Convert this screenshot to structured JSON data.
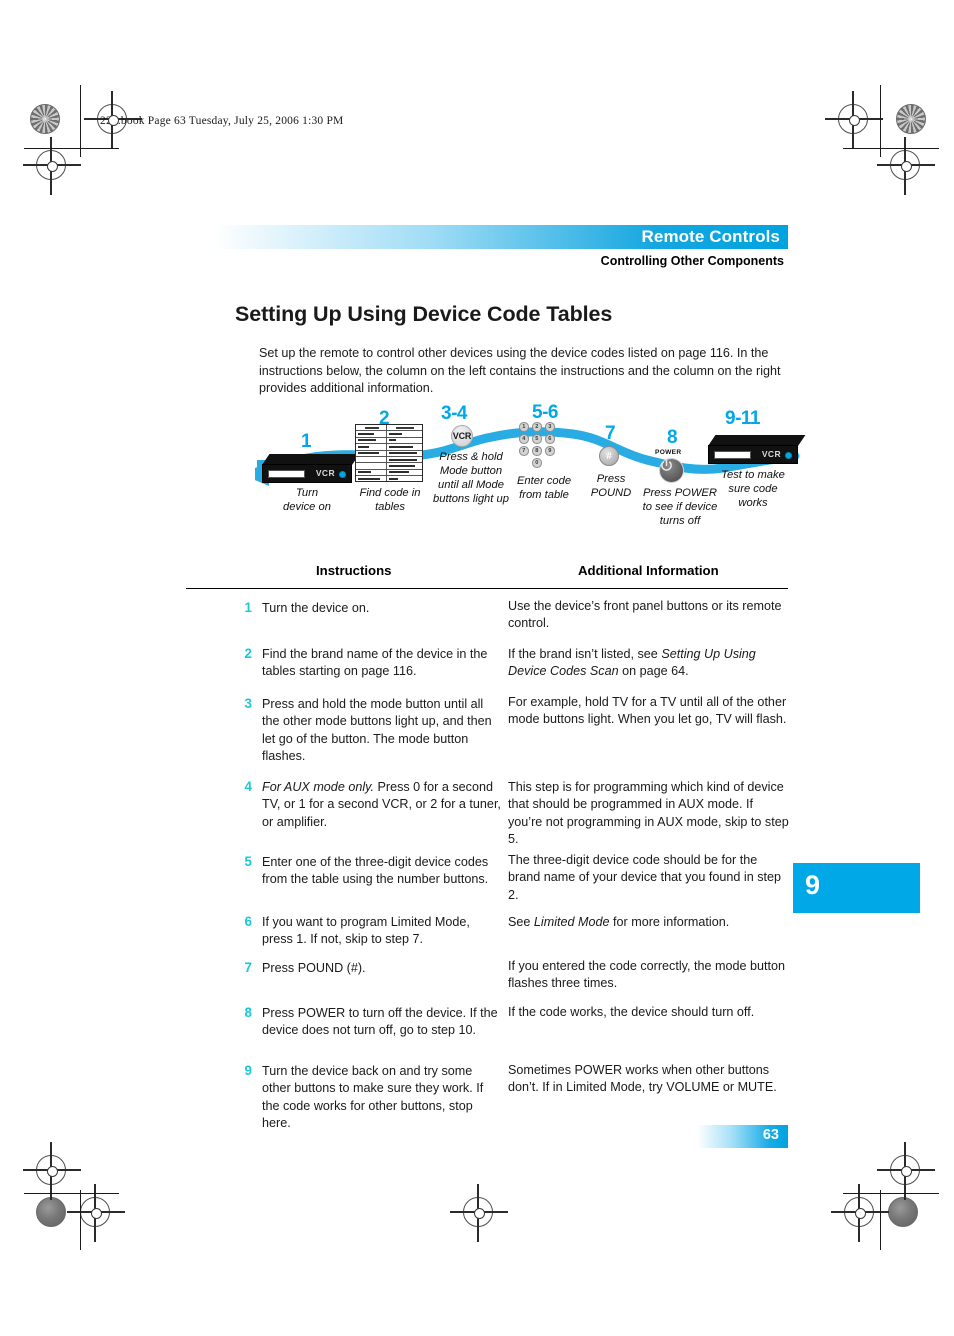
{
  "print_slug": "222.book  Page 63  Tuesday, July 25, 2006  1:30 PM",
  "header": {
    "bar_title": "Remote Controls",
    "subtitle": "Controlling Other Components"
  },
  "page_title": "Setting Up Using Device Code Tables",
  "intro": "Set up the remote to control other devices using the device codes listed on page 116. In the instructions below, the column on the left contains the instructions and the column on the right provides additional information.",
  "diagram": {
    "steps": [
      {
        "number": "1",
        "caption": "Turn\ndevice on",
        "icon": "device-box-icon"
      },
      {
        "number": "2",
        "caption": "Find code in\ntables",
        "icon": "code-table-icon"
      },
      {
        "number": "3-4",
        "caption": "Press & hold\nMode button\nuntil all Mode\nbuttons light up",
        "icon": "vcr-mode-button-icon"
      },
      {
        "number": "5-6",
        "caption": "Enter code\nfrom table",
        "icon": "number-keypad-icon"
      },
      {
        "number": "7",
        "caption": "Press\nPOUND",
        "icon": "pound-button-icon"
      },
      {
        "number": "8",
        "caption": "Press POWER\nto see if device\nturns off",
        "icon": "power-button-icon"
      },
      {
        "number": "9-11",
        "caption": "Test to make\nsure code\nworks",
        "icon": "device-box-icon"
      }
    ],
    "mode_button_label": "VCR",
    "pound_button_label": "#",
    "power_button_label": "POWER",
    "device_label": "VCR",
    "keypad_keys": [
      "1",
      "2",
      "3",
      "4",
      "5",
      "6",
      "7",
      "8",
      "9",
      "0"
    ]
  },
  "table": {
    "columns": [
      "Instructions",
      "Additional Information"
    ],
    "rows": [
      {
        "number": "1",
        "instruction": "Turn the device on.",
        "additional": "Use the device’s front panel buttons or its remote control."
      },
      {
        "number": "2",
        "instruction": "Find the brand name of the device in the tables starting on page 116.",
        "additional_pre": "If the brand isn’t listed, see ",
        "additional_em": "Setting Up Using Device Codes Scan",
        "additional_post": " on page 64."
      },
      {
        "number": "3",
        "instruction": "Press and hold the mode button until all the other mode buttons light up, and then let go of the button. The mode button flashes.",
        "additional": "For example, hold TV for a TV until all of the other mode buttons light. When you let go, TV will flash."
      },
      {
        "number": "4",
        "instruction_em": "For AUX mode only.",
        "instruction_post": " Press 0 for a second TV, or 1 for a second VCR, or 2 for a tuner, or amplifier.",
        "additional": "This step is for programming which kind of device that should be programmed in AUX mode. If you’re not programming in AUX mode, skip to step 5."
      },
      {
        "number": "5",
        "instruction": "Enter one of the three-digit device codes from the table using the number buttons.",
        "additional": "The three-digit device code should be for the brand name of your device that you found in step 2."
      },
      {
        "number": "6",
        "instruction": "If you want to program Limited Mode, press 1. If not, skip to step 7.",
        "additional_pre": "See ",
        "additional_em": "Limited Mode",
        "additional_post": " for more information."
      },
      {
        "number": "7",
        "instruction": "Press POUND (#).",
        "additional": "If you entered the code correctly, the mode button flashes three times."
      },
      {
        "number": "8",
        "instruction": "Press POWER to turn off the device. If the device does not turn off, go to step 10.",
        "additional": "If the code works, the device should turn off."
      },
      {
        "number": "9",
        "instruction": "Turn the device back on and try some other buttons to make sure they work. If the code works for other buttons, stop here.",
        "additional": "Sometimes POWER works when other buttons don’t. If in Limited Mode, try VOLUME or MUTE."
      }
    ]
  },
  "chapter_tab": "9",
  "folio": "63",
  "colors": {
    "accent_blue": "#00a8e8",
    "header_blue": "#00a3e0",
    "step_number_teal": "#19c9d6"
  }
}
